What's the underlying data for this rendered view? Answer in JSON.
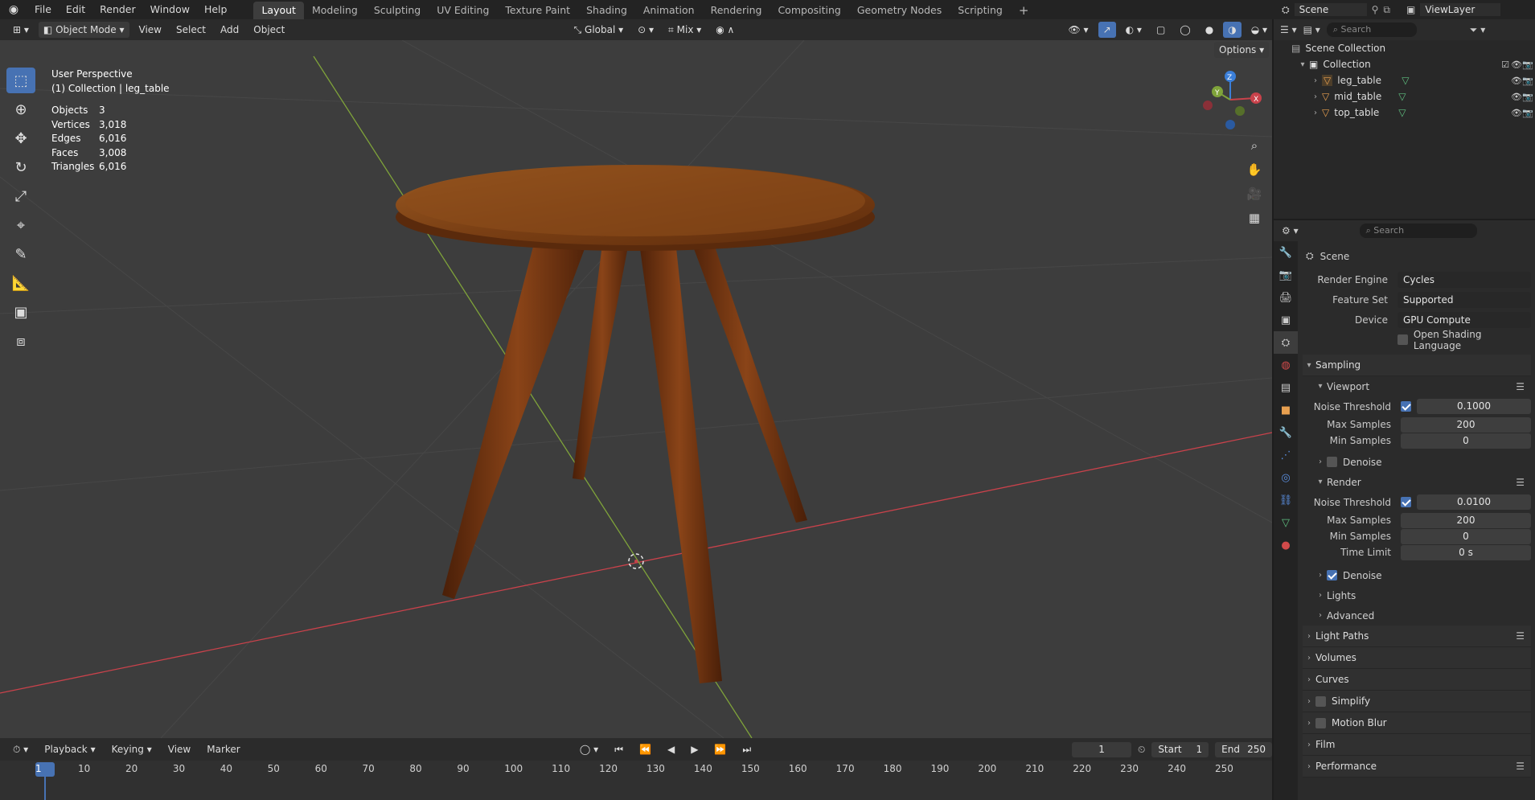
{
  "menu": [
    "File",
    "Edit",
    "Render",
    "Window",
    "Help"
  ],
  "workspaces": [
    "Layout",
    "Modeling",
    "Sculpting",
    "UV Editing",
    "Texture Paint",
    "Shading",
    "Animation",
    "Rendering",
    "Compositing",
    "Geometry Nodes",
    "Scripting"
  ],
  "active_workspace": "Layout",
  "scene": {
    "name": "Scene",
    "view_layer": "ViewLayer"
  },
  "header": {
    "mode": "Object Mode",
    "menus": [
      "View",
      "Select",
      "Add",
      "Object"
    ],
    "orientation": "Global",
    "snap_mode": "Mix",
    "options": "Options"
  },
  "overlay": {
    "perspective": "User Perspective",
    "collection": "(1) Collection | leg_table"
  },
  "stats": [
    {
      "k": "Objects",
      "v": "3"
    },
    {
      "k": "Vertices",
      "v": "3,018"
    },
    {
      "k": "Edges",
      "v": "6,016"
    },
    {
      "k": "Faces",
      "v": "3,008"
    },
    {
      "k": "Triangles",
      "v": "6,016"
    }
  ],
  "outliner": {
    "search": "Search",
    "root": "Scene Collection",
    "collection": "Collection",
    "objects": [
      "leg_table",
      "mid_table",
      "top_table"
    ]
  },
  "properties": {
    "search": "Search",
    "context": "Scene",
    "render_engine": {
      "label": "Render Engine",
      "value": "Cycles"
    },
    "feature_set": {
      "label": "Feature Set",
      "value": "Supported"
    },
    "device": {
      "label": "Device",
      "value": "GPU Compute"
    },
    "osl": "Open Shading Language",
    "sampling": "Sampling",
    "viewport": {
      "title": "Viewport",
      "noise_label": "Noise Threshold",
      "noise": "0.1000",
      "max_label": "Max Samples",
      "max": "200",
      "min_label": "Min Samples",
      "min": "0",
      "denoise": "Denoise"
    },
    "render": {
      "title": "Render",
      "noise_label": "Noise Threshold",
      "noise": "0.0100",
      "max_label": "Max Samples",
      "max": "200",
      "min_label": "Min Samples",
      "min": "0",
      "time_label": "Time Limit",
      "time": "0 s",
      "denoise": "Denoise"
    },
    "subsections": [
      "Lights",
      "Advanced"
    ],
    "panels": [
      "Light Paths",
      "Volumes",
      "Curves",
      "Simplify",
      "Motion Blur",
      "Film",
      "Performance"
    ]
  },
  "timeline": {
    "menus": [
      "Playback",
      "Keying",
      "View",
      "Marker"
    ],
    "current_frame": "1",
    "start_label": "Start",
    "start": "1",
    "end_label": "End",
    "end": "250",
    "ticks": [
      "1",
      "10",
      "20",
      "30",
      "40",
      "50",
      "60",
      "70",
      "80",
      "90",
      "100",
      "110",
      "120",
      "130",
      "140",
      "150",
      "160",
      "170",
      "180",
      "190",
      "200",
      "210",
      "220",
      "230",
      "240",
      "250"
    ]
  },
  "colors": {
    "accent": "#4772b3",
    "x_axis": "#c9424b",
    "y_axis": "#7fa33a",
    "z_axis": "#3b7fd9",
    "wood": "#7a3a16"
  }
}
